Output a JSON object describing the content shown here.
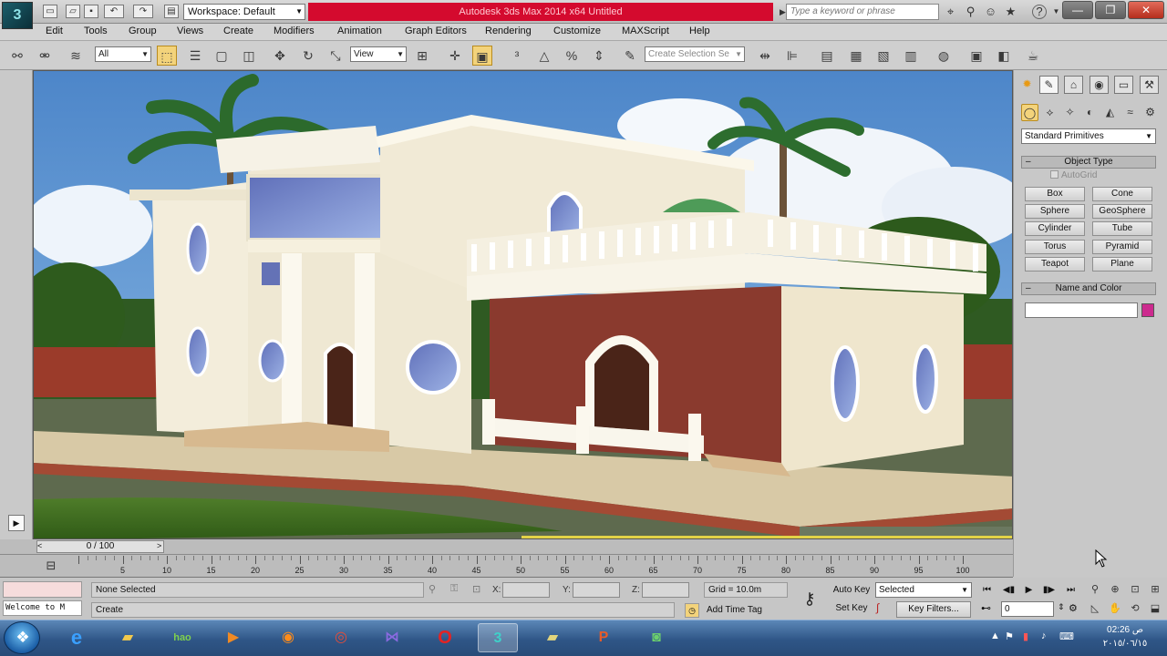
{
  "titlebar": {
    "workspace": "Workspace: Default",
    "app_title": "Autodesk 3ds Max 2014 x64     Untitled",
    "search_placeholder": "Type a keyword or phrase",
    "help_label": "?"
  },
  "menus": [
    "Edit",
    "Tools",
    "Group",
    "Views",
    "Create",
    "Modifiers",
    "Animation",
    "Graph Editors",
    "Rendering",
    "Customize",
    "MAXScript",
    "Help"
  ],
  "toolbar": {
    "selection_filter": "All",
    "reference_coord": "View",
    "selection_set_placeholder": "Create Selection Se"
  },
  "command_panel": {
    "category": "Standard Primitives",
    "object_type_title": "Object Type",
    "autogrid_label": "AutoGrid",
    "objects": [
      "Box",
      "Cone",
      "Sphere",
      "GeoSphere",
      "Cylinder",
      "Tube",
      "Torus",
      "Pyramid",
      "Teapot",
      "Plane"
    ],
    "name_color_title": "Name and Color",
    "object_color": "#cc2a8e"
  },
  "timeline": {
    "frame_display": "0 / 100",
    "ticks": [
      "5",
      "10",
      "15",
      "20",
      "25",
      "30",
      "35",
      "40",
      "45",
      "50",
      "55",
      "60",
      "65",
      "70",
      "75",
      "80",
      "85",
      "90",
      "95",
      "100"
    ]
  },
  "status": {
    "listener_text": "Welcome to M",
    "selection": "None Selected",
    "prompt": "Create",
    "x_label": "X:",
    "y_label": "Y:",
    "z_label": "Z:",
    "grid": "Grid = 10.0m",
    "add_time_tag": "Add Time Tag",
    "auto_key": "Auto Key",
    "set_key": "Set Key",
    "key_mode": "Selected",
    "key_filters": "Key Filters...",
    "current_frame": "0"
  },
  "taskbar": {
    "clock_time": "02:26 ص",
    "clock_date": "٢٠١٥/٠٦/١٥"
  }
}
